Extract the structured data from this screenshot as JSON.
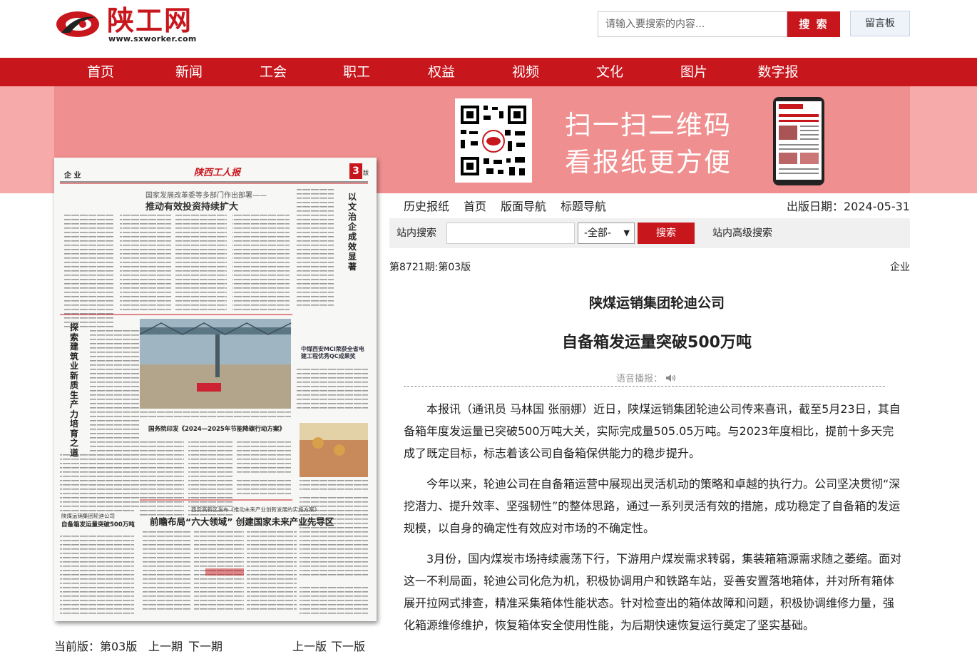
{
  "header": {
    "logo_text": "陕工网",
    "logo_url": "www.sxworker.com",
    "search_placeholder": "请输入要搜索的内容...",
    "search_button": "搜 索",
    "message_board": "留言板"
  },
  "nav": [
    "首页",
    "新闻",
    "工会",
    "职工",
    "权益",
    "视频",
    "文化",
    "图片",
    "数字报"
  ],
  "banner": {
    "line1": "扫一扫二维码",
    "line2": "看报纸更方便"
  },
  "paper_nav": {
    "current_page_label": "当前版：第03版",
    "prev_issue": "上一期",
    "next_issue": "下一期",
    "prev_page": "上一版",
    "next_page": "下一版"
  },
  "toolbar": {
    "history": "历史报纸",
    "home": "首页",
    "page_nav": "版面导航",
    "title_nav": "标题导航",
    "pub_date": "出版日期：2024-05-31"
  },
  "site_search": {
    "label": "站内搜索",
    "scope": "-全部-",
    "button": "搜索",
    "advanced": "站内高级搜索"
  },
  "article": {
    "issue": "第8721期:第03版",
    "section": "企业",
    "subtitle": "陕煤运销集团轮迪公司",
    "title": "自备箱发运量突破500万吨",
    "voice_label": "语音播报：",
    "paragraphs": [
      "本报讯（通讯员 马林国 张丽娜）近日，陕煤运销集团轮迪公司传来喜讯，截至5月23日，其自备箱年度发运量已突破500万吨大关，实际完成量505.05万吨。与2023年度相比，提前十多天完成了既定目标，标志着该公司自备箱保供能力的稳步提升。",
      "今年以来，轮迪公司在自备箱运营中展现出灵活机动的策略和卓越的执行力。公司坚决贯彻“深挖潜力、提升效率、坚强韧性”的整体思路，通过一系列灵活有效的措施，成功稳定了自备箱的发运规模，以自身的确定性有效应对市场的不确定性。",
      "3月份，国内煤炭市场持续震荡下行，下游用户煤炭需求转弱，集装箱箱源需求随之萎缩。面对这一不利局面，轮迪公司化危为机，积极协调用户和铁路车站，妥善安置落地箱体，并对所有箱体展开拉网式排查，精准采集箱体性能状态。针对检查出的箱体故障和问题，积极协调维修力量，强化箱源维修维护，恢复箱体安全使用性能，为后期快速恢复运行奠定了坚实基础。"
    ]
  },
  "paper_image": {
    "masthead": "陕西工人报",
    "section": "企 业",
    "page_no": "3",
    "page_suffix": "版",
    "headline1_kicker": "国家发展改革委等多部门作出部署——",
    "headline1": "推动有效投资持续扩大",
    "headline_side": "以文治企 成效显著",
    "headline_left": "探索建筑业新质生产力培育之道",
    "headline_mid": "国务院印发《2024—2025年节能降碳行动方案》",
    "headline_sub": "西安高新区发布《推动未来产业创新发展的实施方案》",
    "headline_big": "前瞻布局“六大领域” 创建国家未来产业先导区",
    "headline_small1": "陕煤运销集团轮迪公司",
    "headline_small2": "自备箱发运量突破500万吨",
    "headline_right": "中煤西安MCI荣获全省电建工程优秀QC成果奖"
  },
  "colors": {
    "brand_red": "#c8161d",
    "banner_pink": "#f08f8f"
  }
}
